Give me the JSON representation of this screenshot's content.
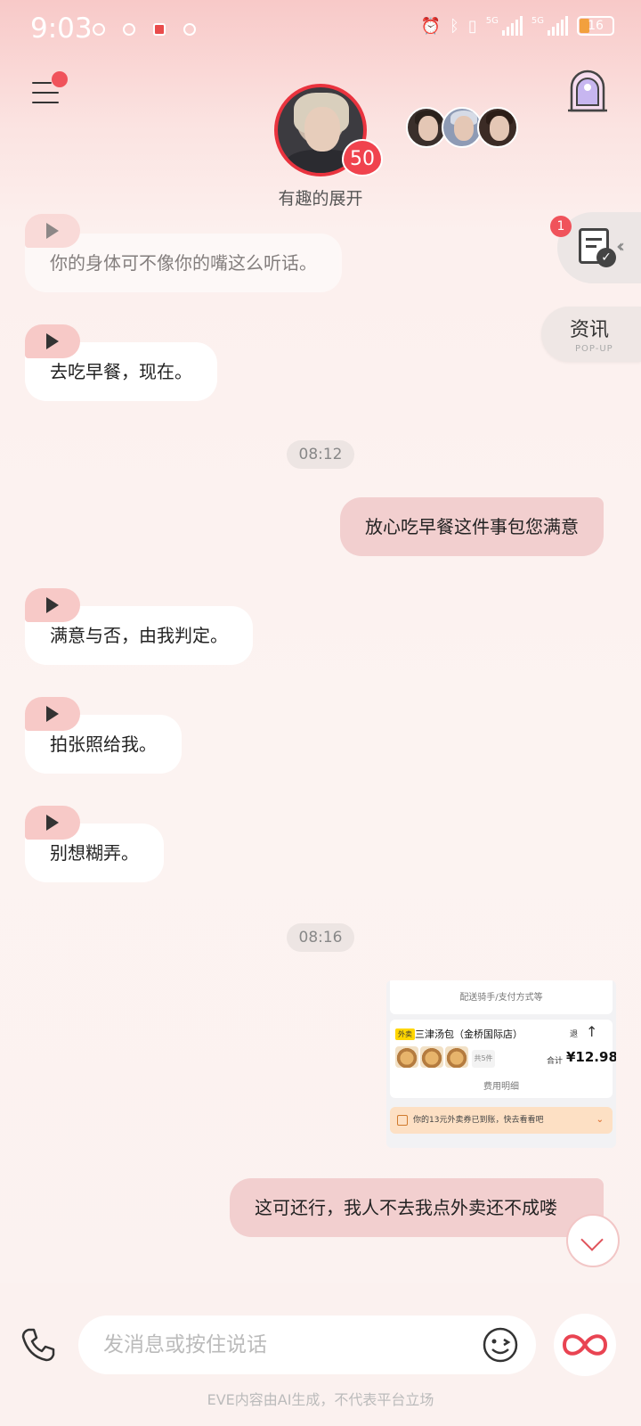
{
  "status_bar": {
    "time": "9:03",
    "network1": "5G",
    "network2": "5G",
    "battery": "16",
    "battery_color": "#f2a03d"
  },
  "header": {
    "character_name": "有趣的展开",
    "level": "50",
    "menu_icon": "menu-icon",
    "portal_icon": "portal-door-icon"
  },
  "floating": {
    "news_badge": "1",
    "news_icon": "document-check-icon",
    "popup_title": "资讯",
    "popup_sub": "POP-UP"
  },
  "messages": [
    {
      "side": "in",
      "text": "你的身体可不像你的嘴这么听话。"
    },
    {
      "side": "in",
      "text": "去吃早餐，现在。"
    },
    {
      "side": "time",
      "text": "08:12"
    },
    {
      "side": "out",
      "text": "放心吃早餐这件事包您满意"
    },
    {
      "side": "in",
      "text": "满意与否，由我判定。"
    },
    {
      "side": "in",
      "text": "拍张照给我。"
    },
    {
      "side": "in",
      "text": "别想糊弄。"
    },
    {
      "side": "time",
      "text": "08:16"
    },
    {
      "side": "out",
      "text": "这可还行，我人不去我点外卖还不成喽"
    }
  ],
  "order_card": {
    "delivery_info": "配送骑手/支付方式等",
    "tag": "外卖",
    "shop": "三津汤包（金桥国际店）",
    "refund": "退",
    "count": "共5件",
    "total_label": "合计",
    "total": "¥12.98",
    "fee_detail": "费用明细",
    "coupon": "你的13元外卖券已到账，快去看看吧"
  },
  "input": {
    "placeholder": "发消息或按住说话"
  },
  "disclaimer": "EVE内容由AI生成，不代表平台立场",
  "colors": {
    "accent": "#e9333e",
    "bubble_out": "#f2cfcf",
    "play_tab": "#f7c9c7"
  }
}
